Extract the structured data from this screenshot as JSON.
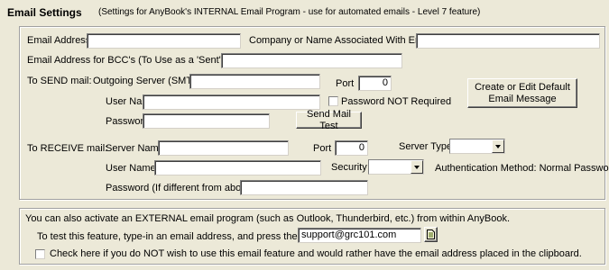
{
  "header": {
    "title": "Email Settings",
    "subtitle": "(Settings for AnyBook's INTERNAL Email Program - use for automated emails - Level 7 feature)"
  },
  "general": {
    "email_address_label": "Email Address",
    "email_address_value": "",
    "company_label": "Company or Name Associated With Email",
    "company_value": "",
    "bcc_label": "Email Address for BCC's (To Use as a 'Sent' Box)",
    "bcc_value": ""
  },
  "send": {
    "section_label": "To SEND mail:",
    "server_label": "Outgoing Server (SMTP)",
    "server_value": "",
    "port_label": "Port",
    "port_value": "0",
    "username_label": "User Name",
    "username_value": "",
    "password_not_required_label": "Password NOT Required",
    "password_label": "Password",
    "password_value": "",
    "test_button": "Send Mail Test",
    "default_msg_button": "Create or Edit Default Email Message"
  },
  "receive": {
    "section_label": "To RECEIVE mail:",
    "server_label": "Server Name",
    "server_value": "",
    "port_label": "Port",
    "port_value": "0",
    "server_type_label": "Server Type",
    "server_type_value": "",
    "username_label": "User Name",
    "username_value": "",
    "security_label": "Security",
    "security_value": "",
    "auth_label": "Authentication Method: Normal Password",
    "password_label": "Password (If different from above)",
    "password_value": ""
  },
  "external": {
    "info_text": "You can also activate an EXTERNAL email program (such as Outlook, Thunderbird, etc.) from within AnyBook.",
    "test_label": "To test this feature, type-in an email address, and press the button:",
    "test_email_value": "support@grc101.com",
    "clipboard_label": "Check here if you do NOT wish to use this email feature and would rather have the email address placed in the clipboard."
  }
}
